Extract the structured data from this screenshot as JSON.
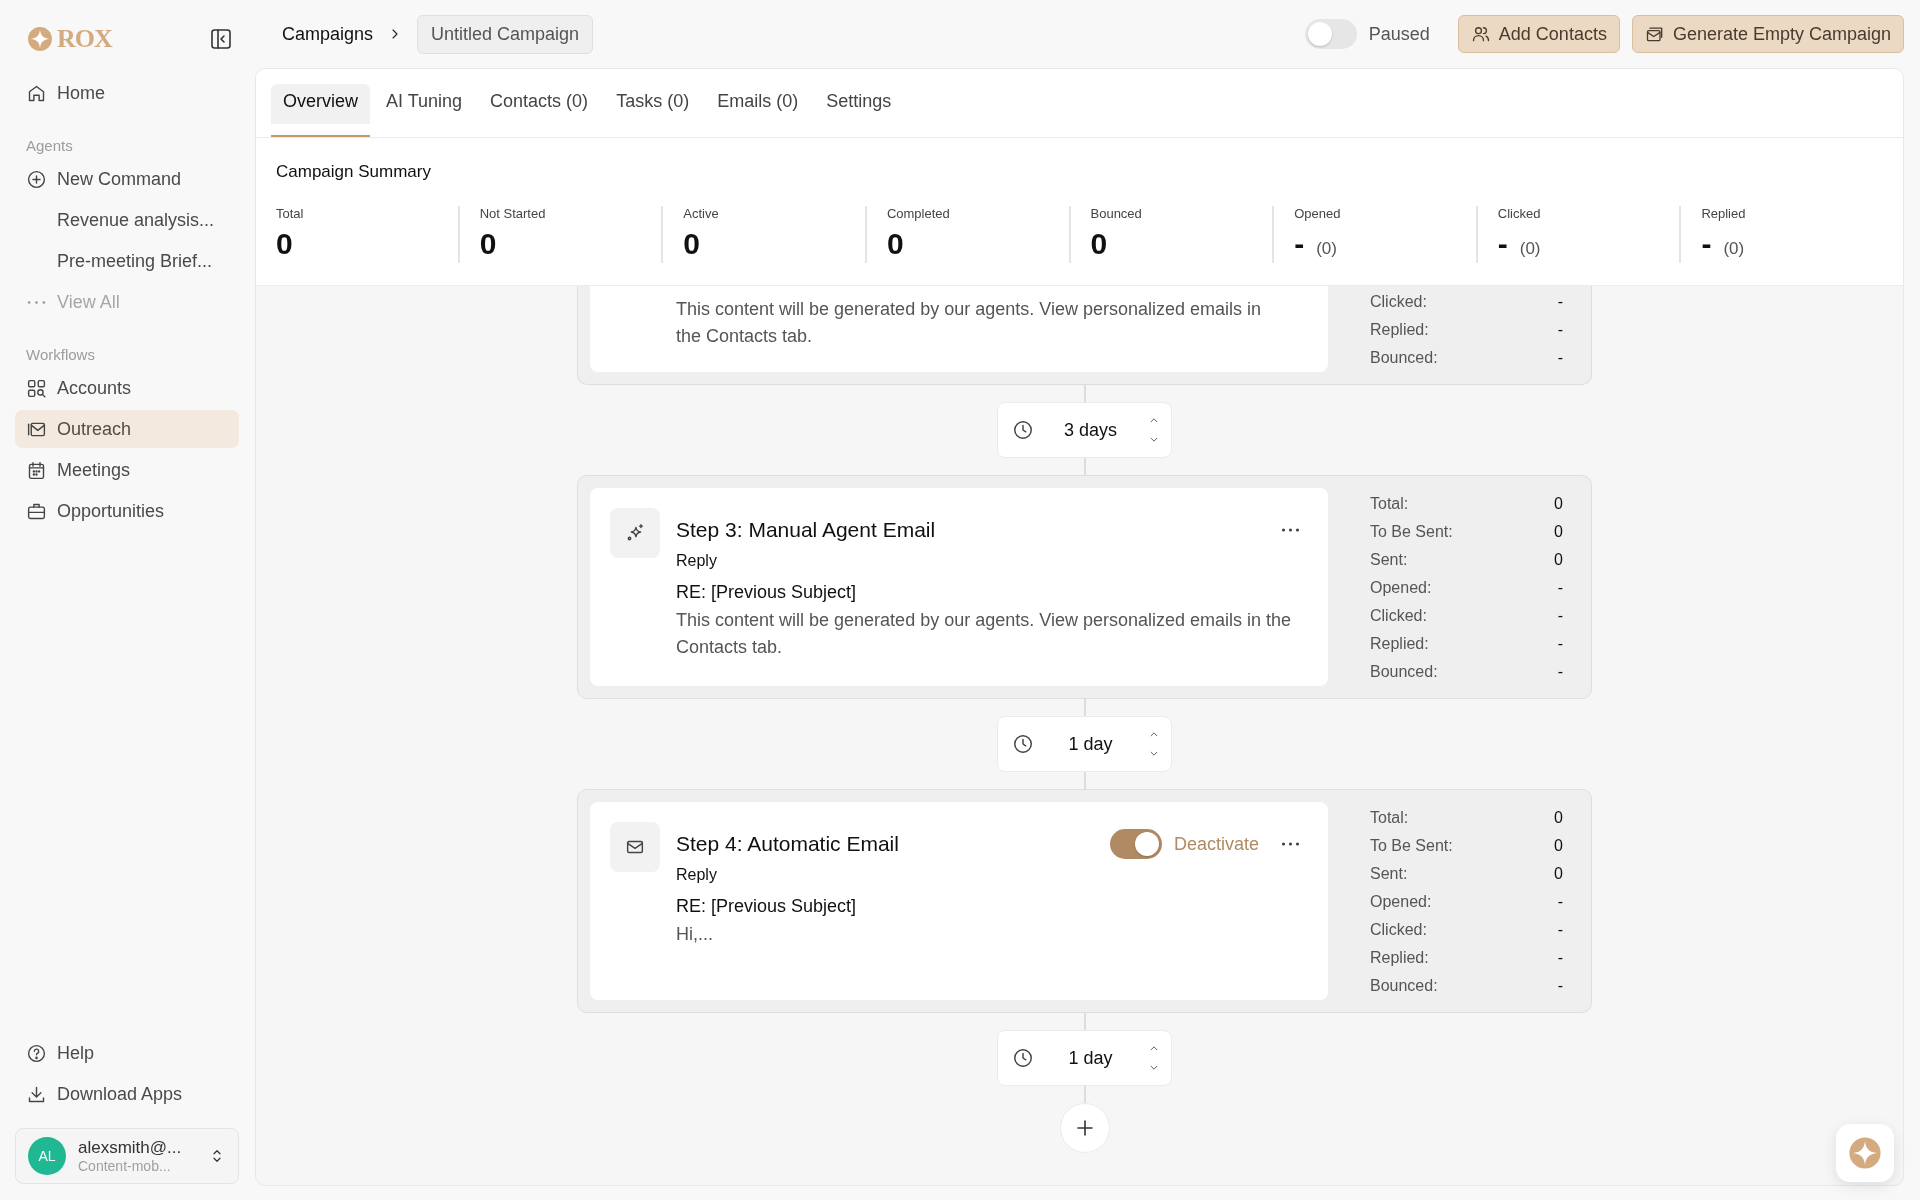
{
  "sidebar": {
    "logo_text": "ROX",
    "top_items": [
      {
        "label": "Home",
        "selected": false
      }
    ],
    "sections": [
      {
        "heading": "Agents",
        "items": [
          {
            "label": "New Command",
            "selected": false
          },
          {
            "label": "Revenue analysis...",
            "selected": false
          },
          {
            "label": "Pre-meeting Brief...",
            "selected": false
          },
          {
            "label": "View All",
            "kind": "more",
            "selected": false
          }
        ]
      },
      {
        "heading": "Workflows",
        "items": [
          {
            "label": "Accounts",
            "selected": false
          },
          {
            "label": "Outreach",
            "selected": true
          },
          {
            "label": "Meetings",
            "selected": false
          },
          {
            "label": "Opportunities",
            "selected": false
          }
        ]
      }
    ],
    "footer_items": [
      {
        "label": "Help",
        "selected": false
      },
      {
        "label": "Download Apps",
        "selected": false
      }
    ],
    "user": {
      "initials": "AL",
      "email": "alexsmith@...",
      "org": "Content-mob...",
      "color": "#1fb893"
    }
  },
  "header": {
    "breadcrumb": {
      "parent": "Campaigns",
      "current": "Untitled Campaign"
    },
    "status_toggle": {
      "label": "Paused",
      "on": false
    },
    "buttons": [
      {
        "label": "Add Contacts"
      },
      {
        "label": "Generate Empty Campaign"
      }
    ]
  },
  "tabs": [
    {
      "label": "Overview",
      "selected": true
    },
    {
      "label": "AI Tuning",
      "selected": false
    },
    {
      "label": "Contacts (0)",
      "selected": false
    },
    {
      "label": "Tasks (0)",
      "selected": false
    },
    {
      "label": "Emails (0)",
      "selected": false
    },
    {
      "label": "Settings",
      "selected": false
    }
  ],
  "summary": {
    "title": "Campaign Summary",
    "metrics": [
      {
        "label": "Total",
        "value": "0"
      },
      {
        "label": "Not Started",
        "value": "0"
      },
      {
        "label": "Active",
        "value": "0"
      },
      {
        "label": "Completed",
        "value": "0"
      },
      {
        "label": "Bounced",
        "value": "0"
      },
      {
        "label": "Opened",
        "value": "-",
        "count": "(0)"
      },
      {
        "label": "Clicked",
        "value": "-",
        "count": "(0)"
      },
      {
        "label": "Replied",
        "value": "-",
        "count": "(0)"
      }
    ]
  },
  "steps": [
    {
      "kind": "partial",
      "body": "This content will be generated by our agents. View personalized emails in the Contacts tab.",
      "stats": [
        {
          "label": "Clicked:",
          "value": "-"
        },
        {
          "label": "Replied:",
          "value": "-"
        },
        {
          "label": "Bounced:",
          "value": "-"
        }
      ],
      "delay": "3 days"
    },
    {
      "kind": "manual",
      "title": "Step 3: Manual Agent Email",
      "type_label": "Reply",
      "subject": "RE: [Previous Subject]",
      "body": "This content will be generated by our agents. View personalized emails in the Contacts tab.",
      "stats": [
        {
          "label": "Total:",
          "value": "0"
        },
        {
          "label": "To Be Sent:",
          "value": "0"
        },
        {
          "label": "Sent:",
          "value": "0"
        },
        {
          "label": "Opened:",
          "value": "-"
        },
        {
          "label": "Clicked:",
          "value": "-"
        },
        {
          "label": "Replied:",
          "value": "-"
        },
        {
          "label": "Bounced:",
          "value": "-"
        }
      ],
      "delay": "1 day"
    },
    {
      "kind": "automatic",
      "title": "Step 4: Automatic Email",
      "type_label": "Reply",
      "subject": "RE: [Previous Subject]",
      "body": "Hi,...",
      "toggle": {
        "label": "Deactivate",
        "on": true
      },
      "stats": [
        {
          "label": "Total:",
          "value": "0"
        },
        {
          "label": "To Be Sent:",
          "value": "0"
        },
        {
          "label": "Sent:",
          "value": "0"
        },
        {
          "label": "Opened:",
          "value": "-"
        },
        {
          "label": "Clicked:",
          "value": "-"
        },
        {
          "label": "Replied:",
          "value": "-"
        },
        {
          "label": "Bounced:",
          "value": "-"
        }
      ],
      "delay": "1 day"
    }
  ]
}
